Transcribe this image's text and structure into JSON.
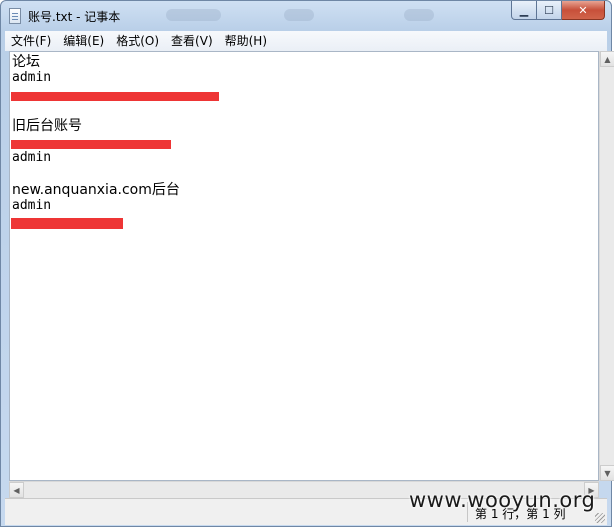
{
  "window": {
    "title": "账号.txt - 记事本",
    "min_glyph": "▁",
    "max_glyph": "☐",
    "close_glyph": "✕"
  },
  "menu": [
    {
      "label": "文件(F)"
    },
    {
      "label": "编辑(E)"
    },
    {
      "label": "格式(O)"
    },
    {
      "label": "查看(V)"
    },
    {
      "label": "帮助(H)"
    }
  ],
  "content": {
    "lines": [
      "论坛",
      "admin",
      "",
      "",
      "旧后台账号",
      "",
      "admin",
      "",
      "new.anquanxia.com后台",
      "admin",
      ""
    ],
    "redaction_color": "#ee3535"
  },
  "scrollbar": {
    "up": "▲",
    "down": "▼",
    "left": "◀",
    "right": "▶"
  },
  "status": {
    "position": "第 1 行，第 1 列"
  },
  "watermark": "www.wooyun.org"
}
